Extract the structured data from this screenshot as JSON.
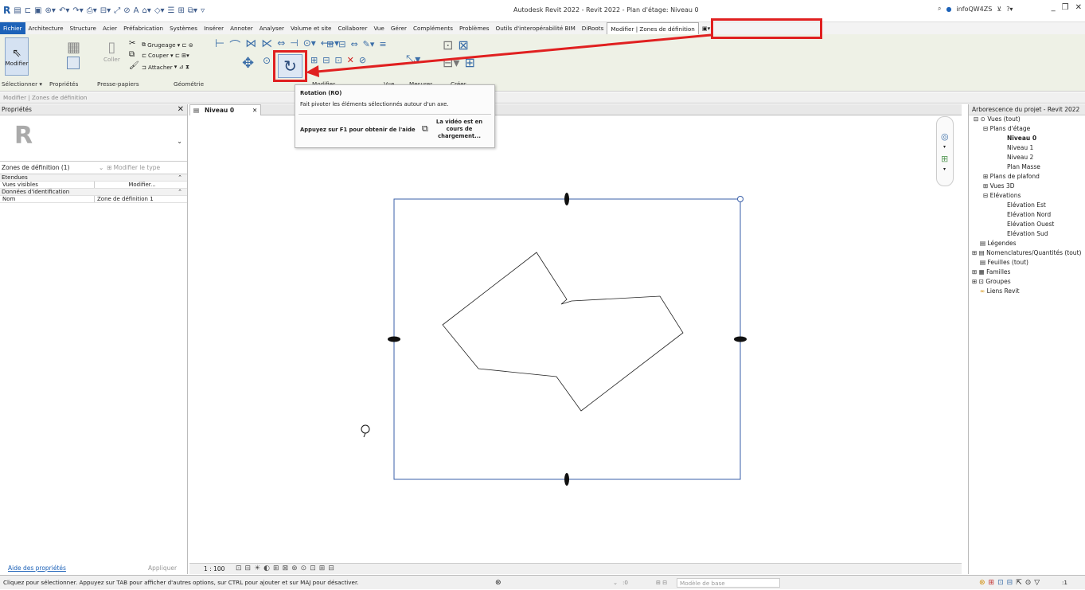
{
  "app": {
    "title": "Autodesk Revit 2022 - Revit 2022 - Plan d'étage: Niveau 0",
    "user": "infoQW4ZS",
    "logo": "R"
  },
  "menu": {
    "tabs": [
      "Fichier",
      "Architecture",
      "Structure",
      "Acier",
      "Préfabrication",
      "Systèmes",
      "Insérer",
      "Annoter",
      "Analyser",
      "Volume et site",
      "Collaborer",
      "Vue",
      "Gérer",
      "Compléments",
      "Problèmes",
      "Outils d'interopérabilité BIM",
      "DiRoots",
      "Modifier | Zones de définition"
    ],
    "active": "Modifier | Zones de définition",
    "extra": "▣▾"
  },
  "ribbon": {
    "modify_label": "Modifier",
    "paste_label": "Coller",
    "cope_label": "Grugeage",
    "cut_label": "Couper",
    "join_label": "Attacher",
    "panels": {
      "select": "Sélectionner ▾",
      "properties": "Propriétés",
      "clipboard": "Presse-papiers",
      "geometry": "Géométrie",
      "modify": "Modifier",
      "view": "Vue",
      "measure": "Mesurer",
      "create": "Créer"
    }
  },
  "context_bar": "Modifier | Zones de définition",
  "tooltip": {
    "title": "Rotation (RO)",
    "description": "Fait pivoter les éléments sélectionnés autour d'un axe.",
    "help": "Appuyez sur F1 pour obtenir de l'aide",
    "video": "La vidéo est en cours de chargement..."
  },
  "properties": {
    "header": "Propriétés",
    "type_selector": "Zones de définition (1)",
    "edit_type": "Modifier le type",
    "sections": {
      "extents": "Etendues",
      "identity": "Données d'identification"
    },
    "rows": {
      "visible_views_key": "Vues visibles",
      "visible_views_value": "Modifier...",
      "name_key": "Nom",
      "name_value": "Zone de définition 1"
    },
    "help_link": "Aide des propriétés",
    "apply": "Appliquer"
  },
  "view": {
    "tab_label": "Niveau 0",
    "scale": "1 : 100"
  },
  "browser": {
    "header": "Arborescence du projet - Revit 2022",
    "items": {
      "views": "Vues (tout)",
      "floor_plans": "Plans d'étage",
      "level0": "Niveau 0",
      "level1": "Niveau 1",
      "level2": "Niveau 2",
      "mass_plan": "Plan Masse",
      "ceiling": "Plans de plafond",
      "views3d": "Vues 3D",
      "elevations": "Elévations",
      "elev_est": "Elévation Est",
      "elev_nord": "Elévation Nord",
      "elev_ouest": "Elévation Ouest",
      "elev_sud": "Elévation Sud",
      "legends": "Légendes",
      "schedules": "Nomenclatures/Quantités (tout)",
      "sheets": "Feuilles (tout)",
      "families": "Familles",
      "groups": "Groupes",
      "links": "Liens Revit"
    }
  },
  "status": {
    "message": "Cliquez pour sélectionner. Appuyez sur TAB pour afficher d'autres options, sur CTRL pour ajouter et sur MAJ pour désactiver.",
    "model": "Modèle de base",
    "count": ":0",
    "filter": ":1"
  },
  "colors": {
    "highlight": "#e02020",
    "accent": "#1d62b8",
    "crop_line": "#3a5fa8"
  }
}
